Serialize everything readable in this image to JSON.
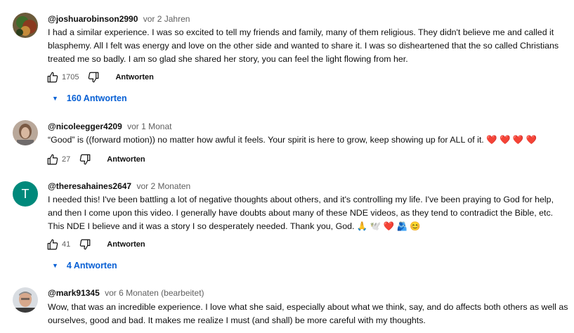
{
  "comments": [
    {
      "author": "@joshuarobinson2990",
      "time": "vor 2 Jahren",
      "lines": [
        "I had a similar experience. I was so excited to tell my friends and family, many of them religious. They didn't believe me and called it",
        "blasphemy. All I felt was energy and love on the other side and wanted to share it. I was so disheartened that the so called Christians",
        "treated me so badly. I am so glad she shared her story, you can feel the light flowing from her."
      ],
      "likes": "1705",
      "reply_label": "Antworten",
      "replies_label": "160 Antworten"
    },
    {
      "author": "@nicoleegger4209",
      "time": "vor 1 Monat",
      "lines": [
        "“Good” is ((forward motion)) no matter how awful it feels.  Your spirit is here to grow, keep showing up for ALL of it. ❤️ ❤️ ❤️ ❤️"
      ],
      "likes": "27",
      "reply_label": "Antworten"
    },
    {
      "author": "@theresahaines2647",
      "time": "vor 2 Monaten",
      "avatar_letter": "T",
      "avatar_color": "#00897b",
      "lines": [
        "I needed this!  I've been battling a lot of negative thoughts about others, and it's controlling my life.  I've been praying to God for help,",
        "and then I come upon this video.  I generally have doubts about many of these NDE videos, as they tend to contradict the Bible, etc.",
        "This NDE I believe and it was a story I so desperately needed.  Thank you, God. 🙏 🕊️ ❤️ 🫂 😊"
      ],
      "likes": "41",
      "reply_label": "Antworten",
      "replies_label": "4 Antworten"
    },
    {
      "author": "@mark91345",
      "time": "vor 6 Monaten (bearbeitet)",
      "lines": [
        "Wow, that was an incredible experience. I love what she said, especially about what we think, say, and do affects both others as well as",
        "ourselves, good and bad.  It makes me realize I must (and shall) be more careful with my thoughts."
      ]
    }
  ],
  "colors": {
    "link": "#065fd4",
    "meta": "#606060",
    "text": "#0f0f0f"
  },
  "icons": [
    "thumbs-up-icon",
    "thumbs-down-icon",
    "chevron-down-icon"
  ]
}
